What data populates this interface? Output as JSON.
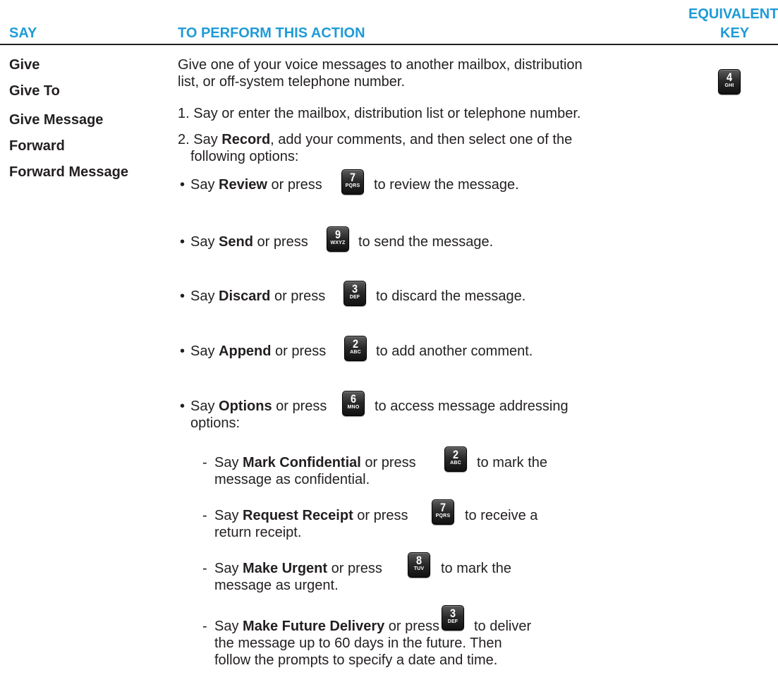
{
  "header": {
    "say": "SAY",
    "action": "TO PERFORM THIS ACTION",
    "key_line1": "EQUIVALENT",
    "key_line2": "KEY"
  },
  "say_commands": [
    "Give",
    "Give To",
    "Give Message",
    "Forward",
    "Forward Message"
  ],
  "equivalent_key": {
    "digit": "4",
    "letters": "GHI"
  },
  "description": {
    "line1": "Give one of your voice messages to another mailbox, distribution",
    "line2": "list, or off-system telephone number."
  },
  "steps": {
    "step1": "1. Say or enter the mailbox, distribution list or telephone number.",
    "step2_pre": "2. Say ",
    "step2_bold": "Record",
    "step2_post": ", add your comments, and then select one of the",
    "step2_line2": "following options:"
  },
  "options": [
    {
      "pre": "Say ",
      "bold": "Review",
      "mid": " or press",
      "digit": "7",
      "letters": "PQRS",
      "post": "to review the message."
    },
    {
      "pre": "Say ",
      "bold": "Send",
      "mid": " or press",
      "digit": "9",
      "letters": "WXYZ",
      "post": "to send the message."
    },
    {
      "pre": "Say ",
      "bold": "Discard",
      "mid": " or press",
      "digit": "3",
      "letters": "DEF",
      "post": "to discard the message."
    },
    {
      "pre": "Say ",
      "bold": "Append",
      "mid": " or press",
      "digit": "2",
      "letters": "ABC",
      "post": "to add another comment."
    },
    {
      "pre": "Say ",
      "bold": "Options",
      "mid": " or press",
      "digit": "6",
      "letters": "MNO",
      "post": "to access message addressing",
      "post2": "options:"
    }
  ],
  "sub_options": [
    {
      "pre": "Say ",
      "bold": "Mark Confidential",
      "mid": " or press",
      "digit": "2",
      "letters": "ABC",
      "post": "to mark the",
      "line2": "message as confidential."
    },
    {
      "pre": "Say ",
      "bold": "Request Receipt",
      "mid": " or press",
      "digit": "7",
      "letters": "PQRS",
      "post": "to receive a",
      "line2": "return receipt."
    },
    {
      "pre": "Say ",
      "bold": "Make Urgent",
      "mid": " or press",
      "digit": "8",
      "letters": "TUV",
      "post": "to mark the",
      "line2": "message as urgent."
    },
    {
      "pre": "Say ",
      "bold": "Make Future Delivery",
      "mid": " or press",
      "digit": "3",
      "letters": "DEF",
      "post": "to deliver",
      "line2": "the message up to 60 days in the future. Then",
      "line3": "follow the prompts to specify a date and time."
    }
  ],
  "glyphs": {
    "bullet": "•",
    "dash": "-"
  }
}
